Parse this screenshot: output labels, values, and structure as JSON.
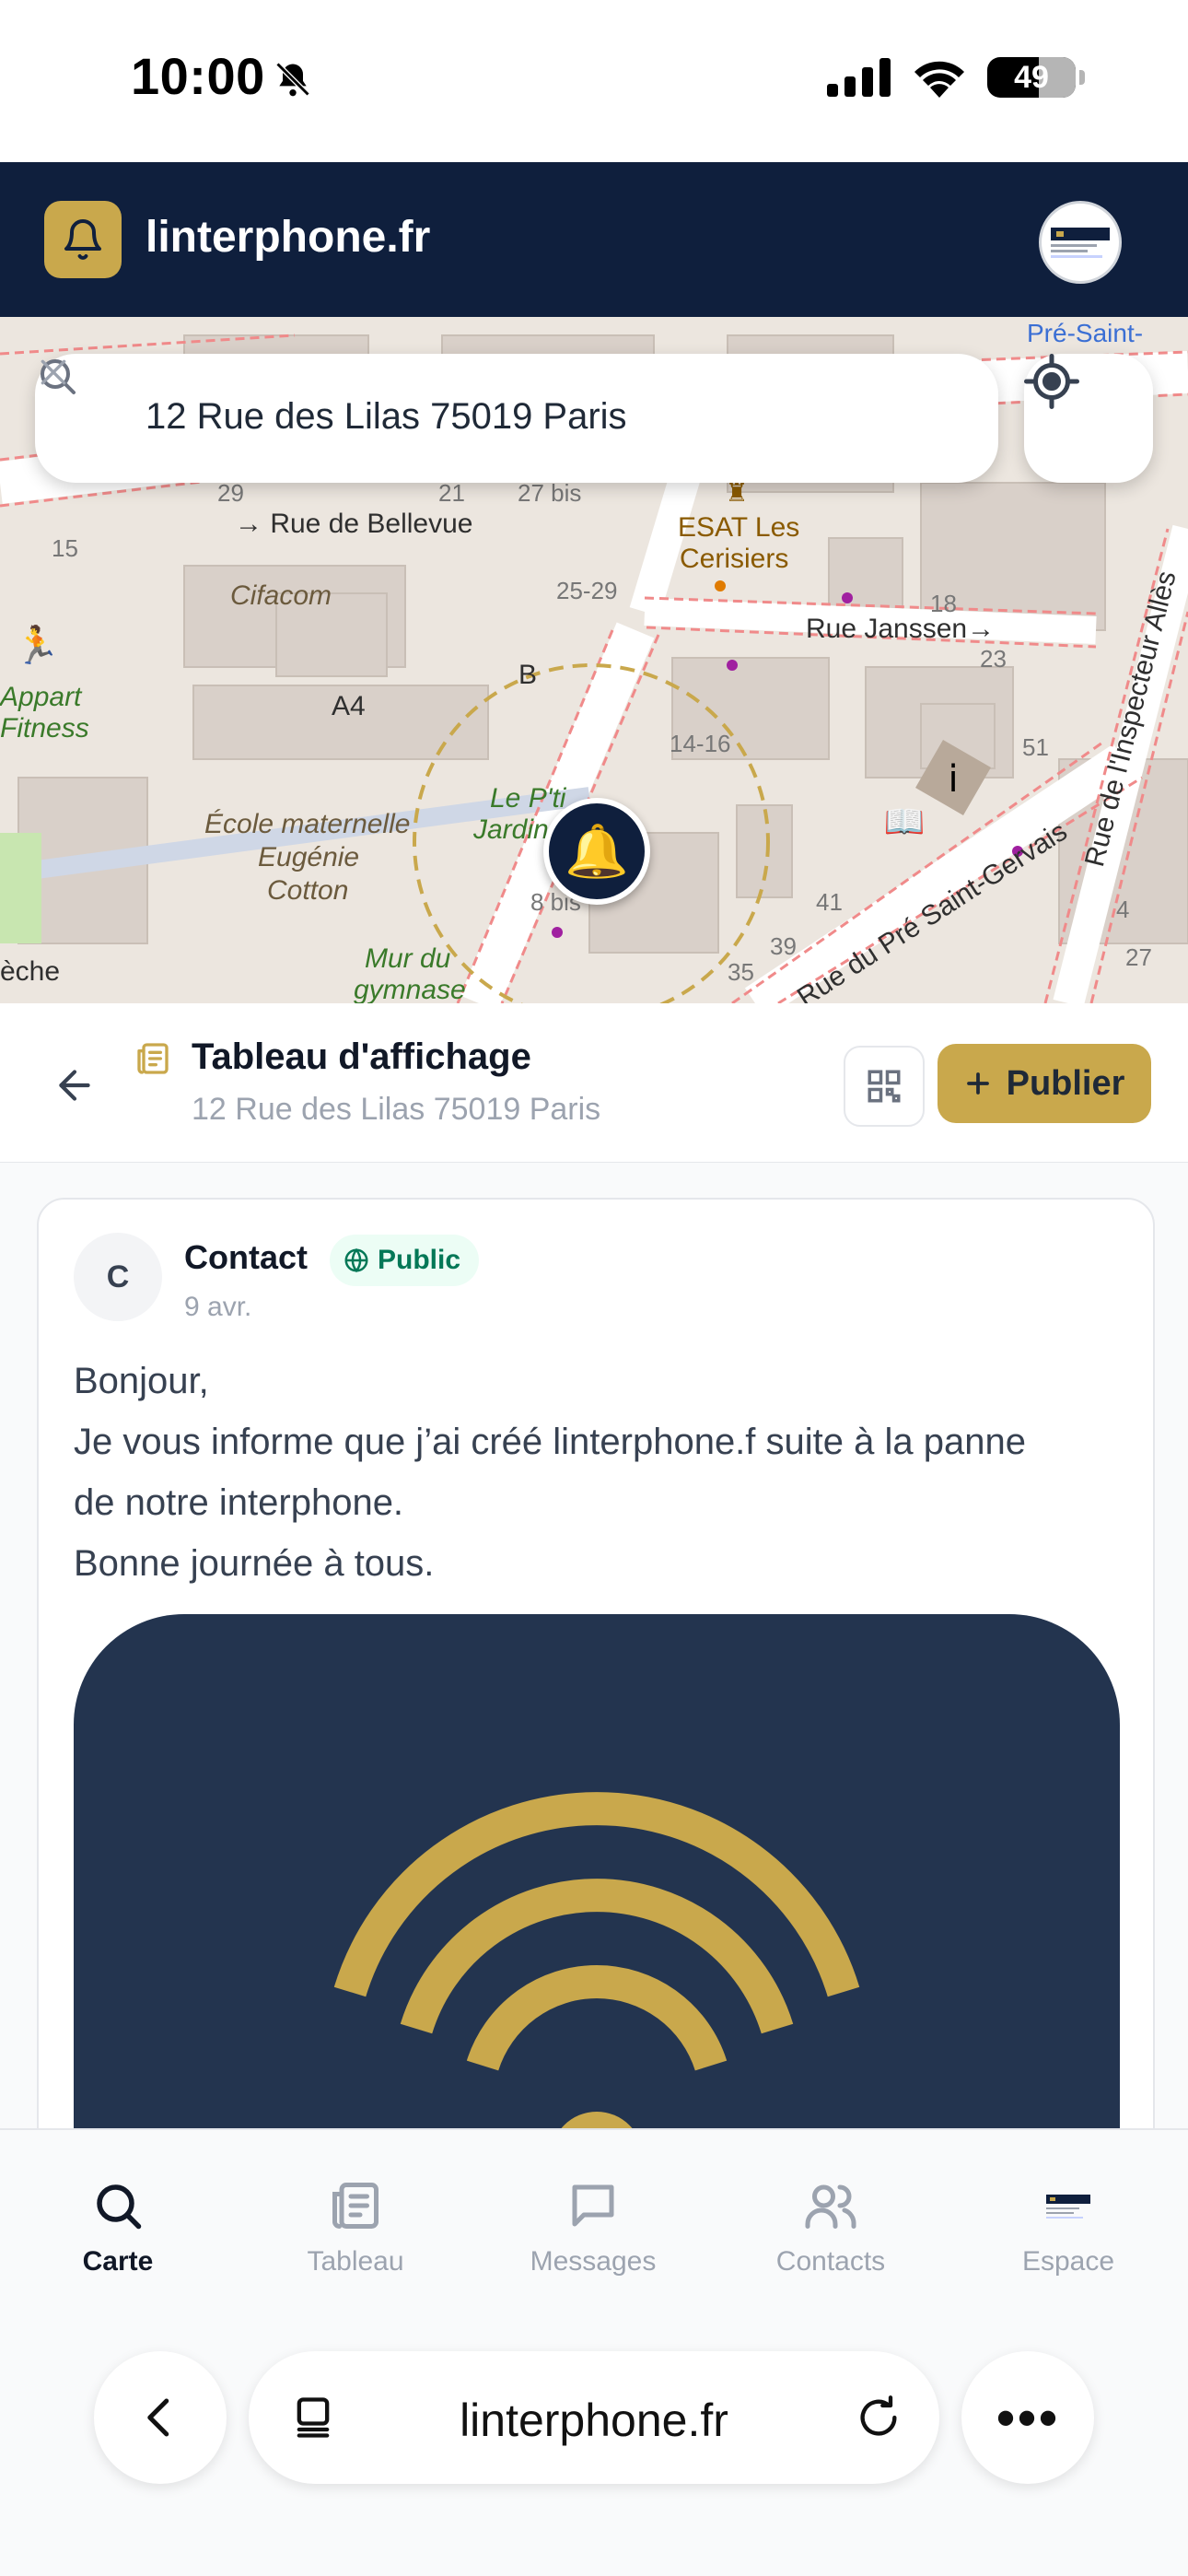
{
  "status_bar": {
    "time": "10:00",
    "battery": "49",
    "icons": [
      "bell-slash-icon",
      "signal-icon",
      "wifi-icon",
      "battery-icon"
    ]
  },
  "header": {
    "title": "linterphone.fr",
    "logo_icon": "bell-icon"
  },
  "map": {
    "search": {
      "value": "12 Rue des Lilas 75019 Paris",
      "icon": "search-icon",
      "clear_icon": "close-icon"
    },
    "locate_icon": "crosshair-icon",
    "labels": {
      "rue_bellevue": "→ Rue de Bellevue",
      "rue_janssen": "Rue Janssen→",
      "pre_saint": "Pré-Saint-",
      "cifacom": "Cifacom",
      "esat1": "ESAT Les",
      "esat2": "Cerisiers",
      "appart1": "Appart",
      "appart2": "Fitness",
      "a4": "A4",
      "b": "B",
      "n1416": "14-16",
      "n2529": "25-29",
      "n18": "18",
      "n23": "23",
      "n51": "51",
      "n41": "41",
      "n39": "39",
      "n35": "35",
      "n4": "4",
      "n27": "27",
      "n8bis": "8 bis",
      "n27bis": "27 bis",
      "n29": "29",
      "n21": "21",
      "n15": "15",
      "ecole1": "École maternelle",
      "ecole2": "Eugénie",
      "ecole3": "Cotton",
      "jardin1": "Le P'ti",
      "jardin2": "Jardin d'E",
      "mur1": "Mur du",
      "mur2": "gymnase",
      "rue_pre": "Rue du Pré Saint-Gervais",
      "rue_inspecteur": "Rue de l'Inspecteur Allès",
      "eche": "èche"
    },
    "pin_icon": "bell-icon",
    "accent_color": "#c9a84c"
  },
  "board": {
    "title": "Tableau d'affichage",
    "address": "12 Rue des Lilas 75019 Paris",
    "publish_label": "Publier",
    "icons": [
      "arrow-left-icon",
      "newspaper-icon",
      "qr-code-icon",
      "plus-icon"
    ]
  },
  "post": {
    "avatar_initial": "C",
    "author": "Contact",
    "visibility": "Public",
    "date": "9 avr.",
    "lines": [
      "Bonjour,",
      "Je vous informe que j’ai créé linterphone.f suite à la panne",
      "de notre interphone.",
      "Bonne journée à tous."
    ],
    "image_icon": "wifi-signal-logo"
  },
  "tabs": [
    {
      "label": "Carte",
      "icon": "search-icon",
      "active": true
    },
    {
      "label": "Tableau",
      "icon": "newspaper-icon",
      "active": false
    },
    {
      "label": "Messages",
      "icon": "message-icon",
      "active": false
    },
    {
      "label": "Contacts",
      "icon": "users-icon",
      "active": false
    },
    {
      "label": "Espace",
      "icon": "thumbnail-icon",
      "active": false
    }
  ],
  "browser": {
    "url": "linterphone.fr",
    "more": "•••"
  },
  "colors": {
    "navy": "#0f1f3d",
    "gold": "#c9a84c",
    "public_green": "#047857"
  }
}
